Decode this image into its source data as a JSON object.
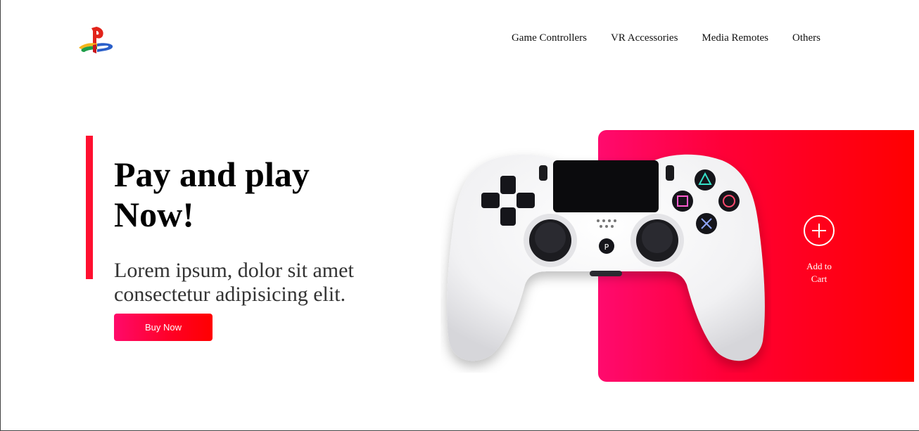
{
  "brand": {
    "logo_icon": "playstation-logo-icon"
  },
  "nav": {
    "items": [
      {
        "label": "Game Controllers"
      },
      {
        "label": "VR Accessories"
      },
      {
        "label": "Media Remotes"
      },
      {
        "label": "Others"
      }
    ]
  },
  "hero": {
    "headline_line1": "Pay and play",
    "headline_line2": "Now!",
    "subtext": "Lorem ipsum, dolor sit amet consectetur adipisicing elit.",
    "buy_label": "Buy Now"
  },
  "product": {
    "image_icon": "game-controller-image",
    "cart_icon": "plus-circle-icon",
    "cart_label_line1": "Add to",
    "cart_label_line2": "Cart"
  },
  "colors": {
    "accent": "#ff0f2f",
    "gradient_start": "#ff0a6e",
    "gradient_end": "#ff0000"
  }
}
